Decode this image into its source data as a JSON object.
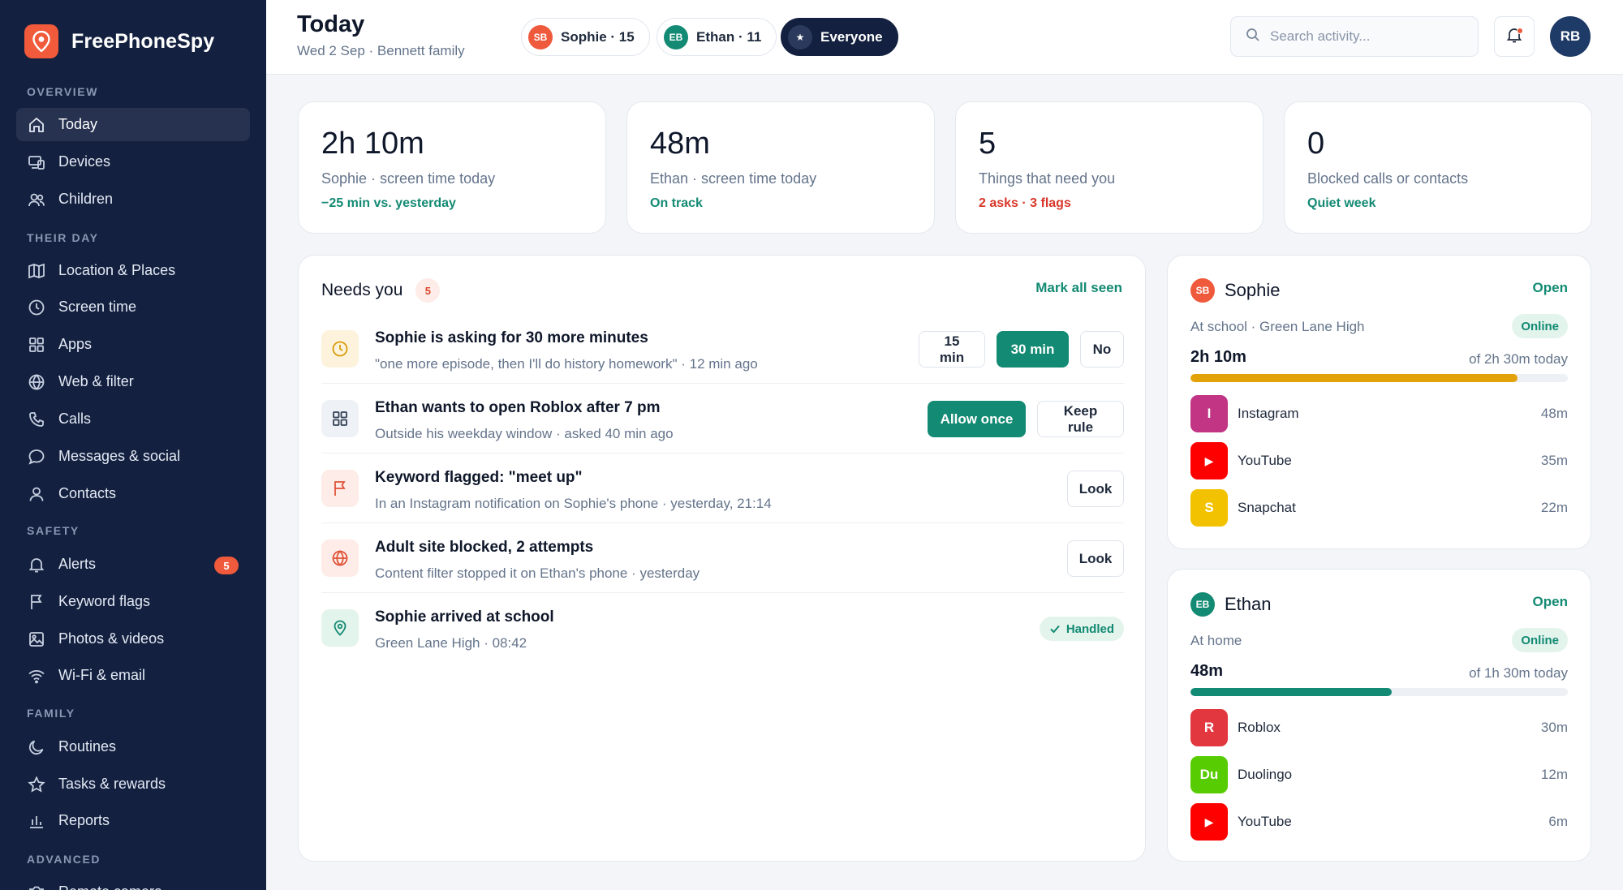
{
  "colors": {
    "sidebar": "#13203f",
    "accent": "#138a73",
    "alert": "#ef5a3c",
    "sophie": "#ef5a3c",
    "ethan": "#138a73",
    "sophie_bar": "#e3a20a"
  },
  "brand": {
    "name": "FreePhoneSpy",
    "icon": "location-pin-icon"
  },
  "sidebar": {
    "sections": {
      "overview": "OVERVIEW",
      "their_day": "THEIR DAY",
      "safety": "SAFETY",
      "family": "FAMILY",
      "advanced": "ADVANCED"
    },
    "items": [
      {
        "label": "Today",
        "icon": "home-icon",
        "active": true
      },
      {
        "label": "Devices",
        "icon": "devices-icon"
      },
      {
        "label": "Children",
        "icon": "users-icon"
      },
      {
        "label": "Location & Places",
        "icon": "map-icon"
      },
      {
        "label": "Screen time",
        "icon": "clock-icon"
      },
      {
        "label": "Apps",
        "icon": "grid-icon"
      },
      {
        "label": "Web & filter",
        "icon": "globe-icon"
      },
      {
        "label": "Calls",
        "icon": "phone-icon"
      },
      {
        "label": "Messages & social",
        "icon": "chat-icon"
      },
      {
        "label": "Contacts",
        "icon": "user-icon"
      },
      {
        "label": "Alerts",
        "icon": "bell-icon",
        "badge": "5"
      },
      {
        "label": "Keyword flags",
        "icon": "flag-icon"
      },
      {
        "label": "Photos & videos",
        "icon": "image-icon"
      },
      {
        "label": "Wi-Fi & email",
        "icon": "wifi-icon"
      },
      {
        "label": "Routines",
        "icon": "moon-icon"
      },
      {
        "label": "Tasks & rewards",
        "icon": "star-icon"
      },
      {
        "label": "Reports",
        "icon": "bar-chart-icon"
      },
      {
        "label": "Remote camera",
        "icon": "camera-icon"
      }
    ]
  },
  "header": {
    "title": "Today",
    "subtitle": "Wed 2 Sep · Bennett family",
    "filters": [
      {
        "initials": "SB",
        "label": "Sophie · 15"
      },
      {
        "initials": "EB",
        "label": "Ethan · 11"
      },
      {
        "initials": "★",
        "label": "Everyone",
        "selected": true
      }
    ],
    "search_placeholder": "Search activity...",
    "avatar": "RB"
  },
  "stats": [
    {
      "value": "2h 10m",
      "label": "Sophie · screen time today",
      "note": "−25 min vs. yesterday",
      "note_color": "#138a73"
    },
    {
      "value": "48m",
      "label": "Ethan · screen time today",
      "note": "On track",
      "note_color": "#138a73"
    },
    {
      "value": "5",
      "label": "Things that need you",
      "note": "2 asks · 3 flags",
      "note_color": "#d9372a"
    },
    {
      "value": "0",
      "label": "Blocked calls or contacts",
      "note": "Quiet week",
      "note_color": "#138a73"
    }
  ],
  "needs": {
    "title": "Needs you",
    "count": "5",
    "mark_all": "Mark all seen",
    "items": [
      {
        "title": "Sophie is asking for 30 more minutes",
        "subtitle": "\"one more episode, then I'll do history homework\" · 12 min ago",
        "icon": "clock-icon",
        "actions": [
          "15 min",
          "30 min",
          "No"
        ]
      },
      {
        "title": "Ethan wants to open Roblox after 7 pm",
        "subtitle": "Outside his weekday window · asked 40 min ago",
        "icon": "grid-icon",
        "actions": [
          "Allow once",
          "Keep rule"
        ]
      },
      {
        "title": "Keyword flagged: \"meet up\"",
        "subtitle": "In an Instagram notification on Sophie's phone · yesterday, 21:14",
        "icon": "flag-icon",
        "actions": [
          "Look"
        ]
      },
      {
        "title": "Adult site blocked, 2 attempts",
        "subtitle": "Content filter stopped it on Ethan's phone · yesterday",
        "icon": "globe-icon",
        "actions": [
          "Look"
        ]
      },
      {
        "title": "Sophie arrived at school",
        "subtitle": "Green Lane High · 08:42",
        "icon": "location-pin-icon",
        "status": "Handled"
      }
    ]
  },
  "children": [
    {
      "initials": "SB",
      "name": "Sophie",
      "open": "Open",
      "where": "At school · Green Lane High",
      "status": "Online",
      "used": "2h 10m",
      "limit": "of 2h 30m today",
      "progress": 0.867,
      "apps": [
        {
          "letter": "I",
          "name": "Instagram",
          "time": "48m",
          "color": "#c13584"
        },
        {
          "letter": "▶",
          "name": "YouTube",
          "time": "35m",
          "color": "#ff0000"
        },
        {
          "letter": "S",
          "name": "Snapchat",
          "time": "22m",
          "color": "#f2c200"
        }
      ]
    },
    {
      "initials": "EB",
      "name": "Ethan",
      "open": "Open",
      "where": "At home",
      "status": "Online",
      "used": "48m",
      "limit": "of 1h 30m today",
      "progress": 0.533,
      "apps": [
        {
          "letter": "R",
          "name": "Roblox",
          "time": "30m",
          "color": "#e2373f"
        },
        {
          "letter": "Du",
          "name": "Duolingo",
          "time": "12m",
          "color": "#58cc02"
        },
        {
          "letter": "▶",
          "name": "YouTube",
          "time": "6m",
          "color": "#ff0000"
        }
      ]
    }
  ]
}
